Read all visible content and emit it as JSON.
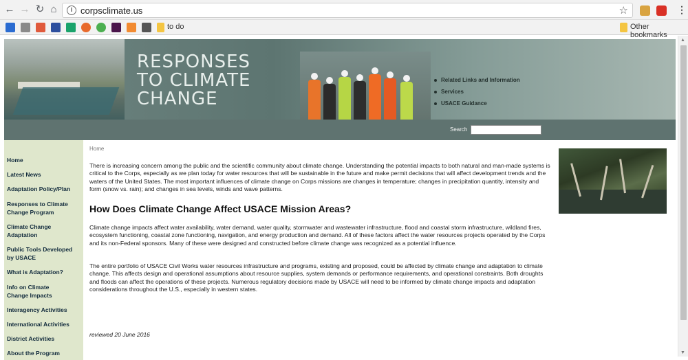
{
  "browser": {
    "url": "corpsclimate.us",
    "bookmarks_folder": "to do",
    "other_bookmarks": "Other bookmarks"
  },
  "banner": {
    "title_line1": "RESPONSES",
    "title_line2": "TO CLIMATE",
    "title_line3": "CHANGE",
    "links": [
      "Related Links and Information",
      "Services",
      "USACE Guidance"
    ],
    "search_label": "Search",
    "search_value": ""
  },
  "sidebar": {
    "items": [
      "Home",
      "Latest News",
      "Adaptation Policy/Plan",
      "Responses to Climate Change Program",
      "Climate Change Adaptation",
      "Public Tools Developed by USACE",
      "What is Adaptation?",
      "Info on Climate Change Impacts",
      "Interagency Activities",
      "International Activities",
      "District Activities",
      "About the Program"
    ]
  },
  "content": {
    "breadcrumb": "Home",
    "intro": "There is increasing concern among the public and the scientific community about climate change. Understanding the potential impacts to both natural and man-made systems is critical to the Corps, especially as we plan today for water resources that will be sustainable in the future and make permit decisions that will affect development trends and the waters of the United States. The most important influences of climate change on Corps missions are changes in temperature; changes in precipitation quantity, intensity and form (snow vs. rain); and changes in sea levels, winds and wave patterns.",
    "heading": "How Does Climate Change Affect USACE Mission Areas?",
    "para1": "Climate change impacts affect water availability, water demand, water quality, stormwater and wastewater infrastructure, flood and coastal storm infrastructure, wildland fires, ecosystem functioning, coastal zone functioning, navigation, and energy production and demand. All of these factors affect the water resources projects operated by the Corps and its non-Federal sponsors. Many of these were designed and constructed before climate change was recognized as a potential influence.",
    "para2": "The entire portfolio of USACE Civil Works water resources infrastructure and programs, existing and proposed, could be affected by climate change and adaptation to climate change. This affects design and operational assumptions about resource supplies, system demands or performance requirements, and operational constraints. Both droughts and floods can affect the operations of these projects. Numerous regulatory decisions made by USACE will need to be informed by climate change impacts and adaptation considerations throughout the U.S., especially in western states.",
    "reviewed": "reviewed 20 June 2016"
  }
}
